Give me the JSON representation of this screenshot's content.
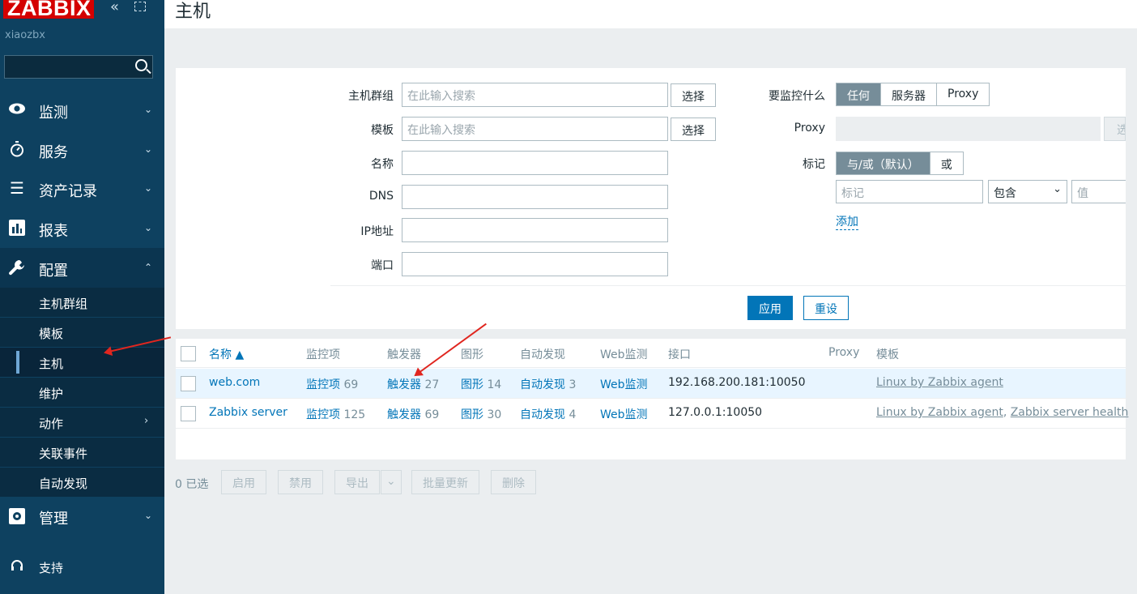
{
  "app": {
    "logo": "ZABBIX",
    "server_name": "xiaozbx",
    "search_placeholder": ""
  },
  "menu": [
    {
      "label": "监测",
      "icon": "eye-icon"
    },
    {
      "label": "服务",
      "icon": "stopwatch-icon"
    },
    {
      "label": "资产记录",
      "icon": "list-icon"
    },
    {
      "label": "报表",
      "icon": "bar-chart-icon"
    },
    {
      "label": "配置",
      "icon": "wrench-icon"
    },
    {
      "label": "管理",
      "icon": "gear-icon"
    },
    {
      "label": "支持",
      "icon": "headset-icon"
    }
  ],
  "submenu": [
    "主机群组",
    "模板",
    "主机",
    "维护",
    "动作",
    "关联事件",
    "自动发现"
  ],
  "page_title": "主机",
  "filter": {
    "host_groups_label": "主机群组",
    "templates_label": "模板",
    "name_label": "名称",
    "dns_label": "DNS",
    "ip_label": "IP地址",
    "port_label": "端口",
    "search_placeholder": "在此输入搜索",
    "select_label": "选择",
    "monitored_by_label": "要监控什么",
    "monitored_by_options": [
      "任何",
      "服务器",
      "Proxy"
    ],
    "proxy_label": "Proxy",
    "proxy_select_partial": "选",
    "tags_label": "标记",
    "tags_mode_options": [
      "与/或（默认）",
      "或"
    ],
    "tag_placeholder": "标记",
    "tag_operator": "包含",
    "tag_value_placeholder": "值",
    "add_label": "添加",
    "apply_label": "应用",
    "reset_label": "重设"
  },
  "table": {
    "headers": {
      "name": "名称 ▲",
      "items": "监控项",
      "triggers": "触发器",
      "graphs": "图形",
      "discovery": "自动发现",
      "web": "Web监测",
      "interface": "接口",
      "proxy": "Proxy",
      "templates": "模板"
    },
    "rows": [
      {
        "name": "web.com",
        "items": "监控项",
        "items_count": "69",
        "triggers": "触发器",
        "triggers_count": "27",
        "graphs": "图形",
        "graphs_count": "14",
        "discovery": "自动发现",
        "discovery_count": "3",
        "web": "Web监测",
        "interface": "192.168.200.181:10050",
        "proxy": "",
        "templates": [
          "Linux by Zabbix agent"
        ]
      },
      {
        "name": "Zabbix server",
        "items": "监控项",
        "items_count": "125",
        "triggers": "触发器",
        "triggers_count": "69",
        "graphs": "图形",
        "graphs_count": "30",
        "discovery": "自动发现",
        "discovery_count": "4",
        "web": "Web监测",
        "interface": "127.0.0.1:10050",
        "proxy": "",
        "templates": [
          "Linux by Zabbix agent",
          "Zabbix server health"
        ],
        "template_separator": ", "
      }
    ]
  },
  "actions": {
    "selected_count": "0 已选",
    "enable": "启用",
    "disable": "禁用",
    "export": "导出",
    "mass_update": "批量更新",
    "delete": "删除"
  },
  "colors": {
    "sidebar": "#0e4160",
    "accent": "#0275b8",
    "logo": "#d40000",
    "annotation_arrow": "#e0261f"
  }
}
